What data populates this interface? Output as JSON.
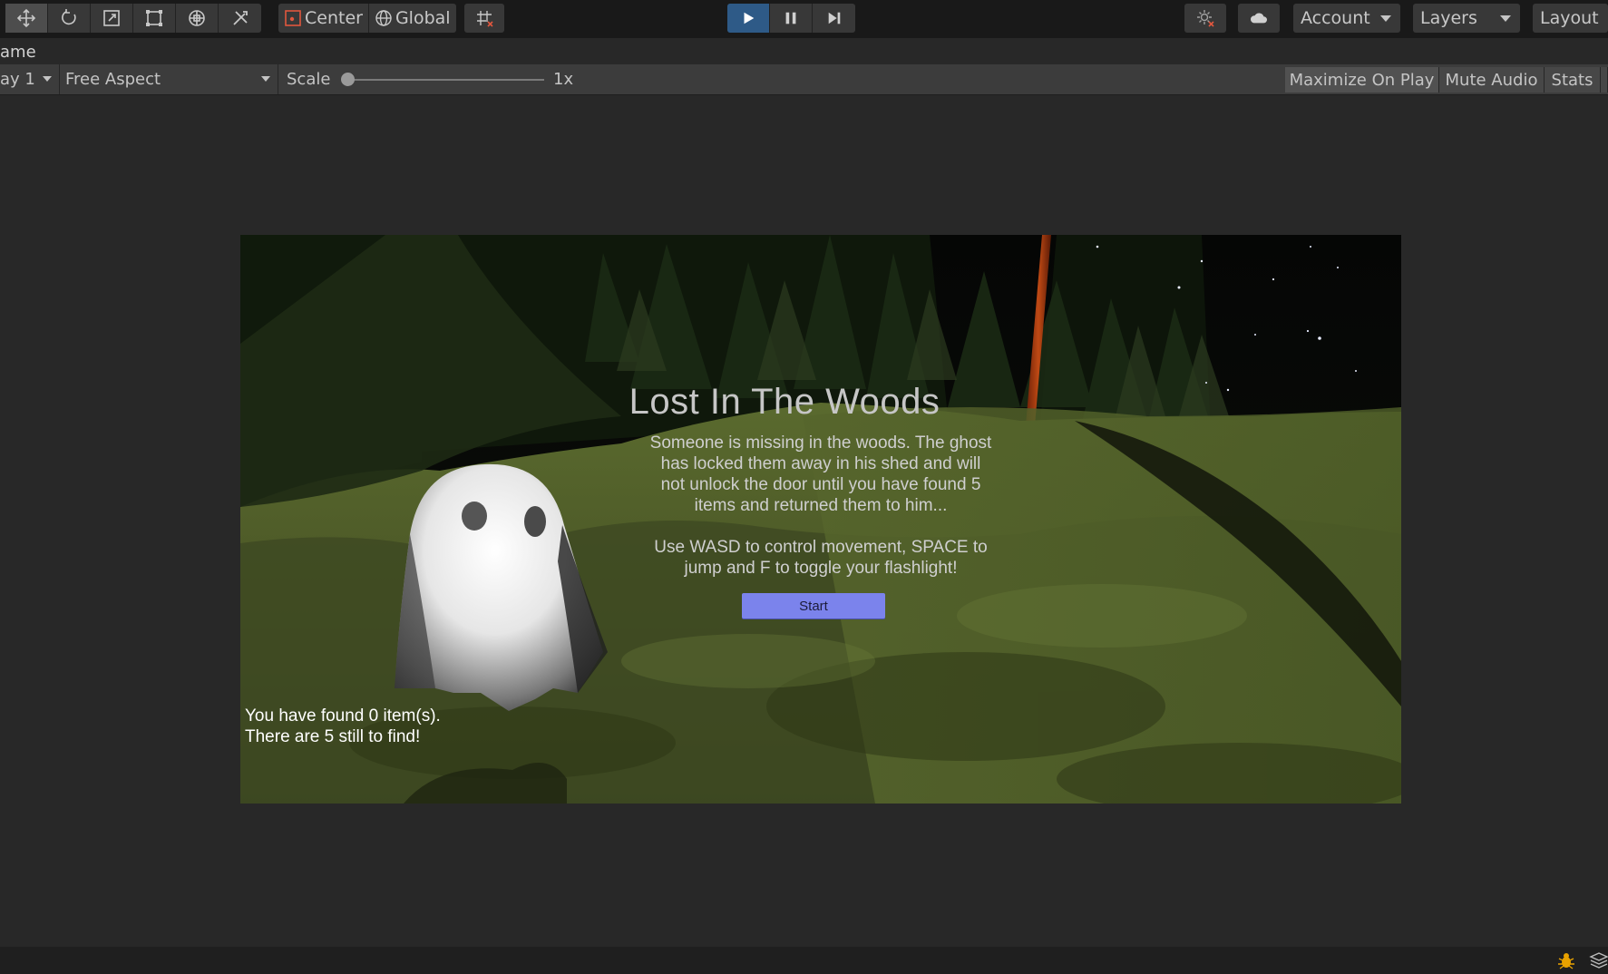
{
  "toolbar": {
    "tools": [
      {
        "name": "move-tool-icon"
      },
      {
        "name": "rotate-tool-icon"
      },
      {
        "name": "scale-tool-icon"
      },
      {
        "name": "rect-tool-icon"
      },
      {
        "name": "transform-tool-icon"
      },
      {
        "name": "custom-tool-icon"
      }
    ],
    "pivot_label": "Center",
    "space_label": "Global",
    "account_label": "Account",
    "layers_label": "Layers",
    "layout_label": "Layout"
  },
  "game_view": {
    "tab_label": "ame",
    "display_label": "ay 1",
    "aspect_label": "Free Aspect",
    "scale_label": "Scale",
    "scale_value": "1x",
    "scale_fraction": 0.0,
    "maximize_label": "Maximize On Play",
    "mute_label": "Mute Audio",
    "stats_label": "Stats"
  },
  "game": {
    "title": "Lost In The Woods",
    "description_lines": [
      "Someone is missing in the woods. The ghost",
      "has locked them away in his shed and will",
      "not unlock the door until you have found 5",
      "items and returned them to him..."
    ],
    "controls_lines": [
      "Use WASD to control movement, SPACE to",
      "jump and F to toggle your flashlight!"
    ],
    "start_label": "Start",
    "found_lines": [
      "You have found 0 item(s).",
      "There are 5 still to find!"
    ]
  },
  "colors": {
    "accent_play": "#2e5a87",
    "start_button": "#7b83ec",
    "editor_bg": "#282828"
  }
}
